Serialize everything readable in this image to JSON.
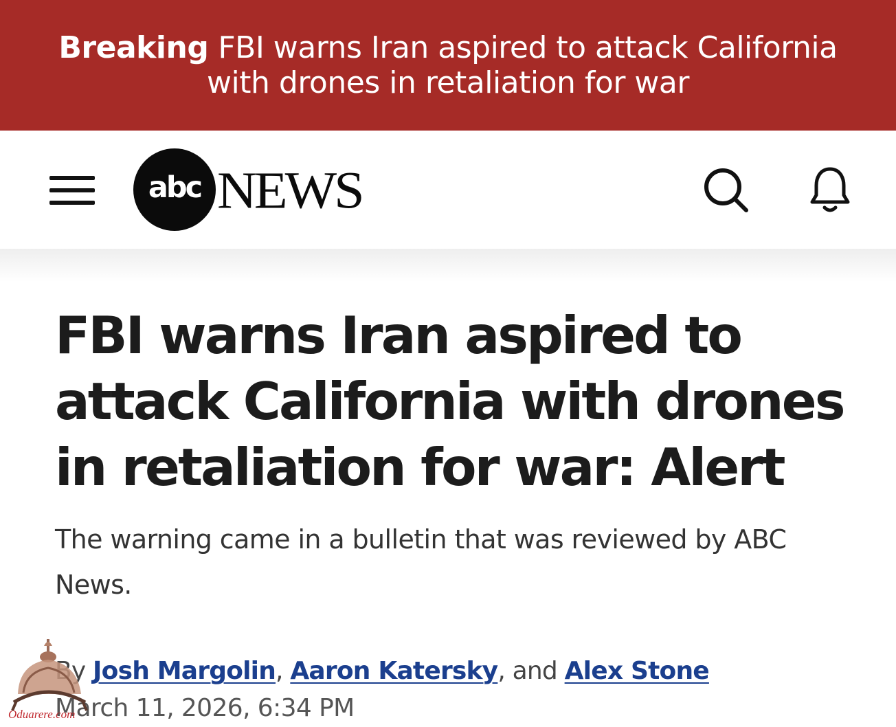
{
  "breaking": {
    "label": "Breaking",
    "text": "FBI warns Iran aspired to attack California with drones in retaliation for war"
  },
  "nav": {
    "menu_icon": "hamburger-menu-icon",
    "logo_abc": "abc",
    "logo_news": "NEWS",
    "search_icon": "search-icon",
    "bell_icon": "bell-icon"
  },
  "article": {
    "headline": "FBI warns Iran aspired to attack California with drones in retaliation for war: Alert",
    "subhead": "The warning came in a bulletin that was reviewed by ABC News.",
    "byline": {
      "prefix": "By ",
      "authors": [
        "Josh Margolin",
        "Aaron Katersky",
        "Alex Stone"
      ],
      "sep1": ", ",
      "sep2": ", and "
    },
    "date": "March 11, 2026, 6:34 PM"
  },
  "watermark": {
    "text": "Oduarere.com",
    "icon": "crown-watermark-icon"
  },
  "colors": {
    "breaking_bg": "#a62b27",
    "link": "#1b3f8e",
    "headline": "#1c1c1c"
  }
}
